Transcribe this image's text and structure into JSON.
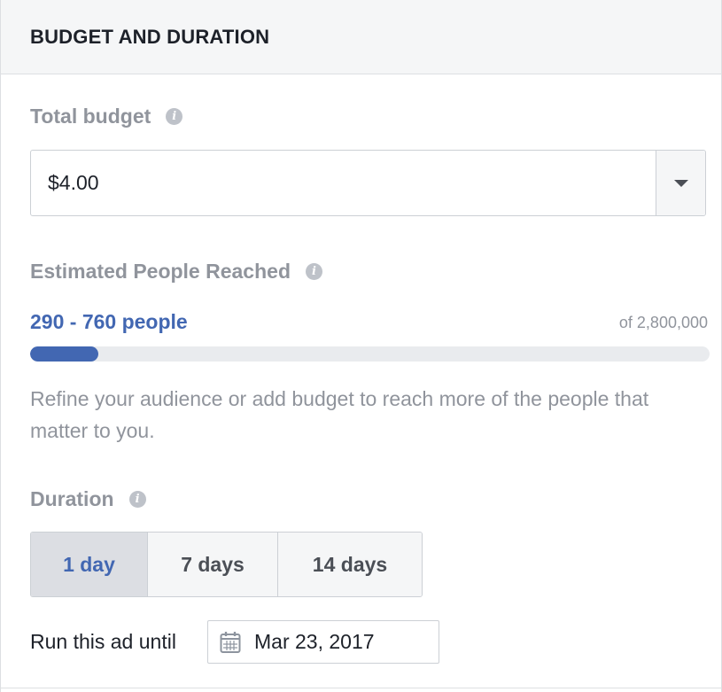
{
  "header": {
    "title": "BUDGET AND DURATION"
  },
  "budget": {
    "label": "Total budget",
    "info_icon": "info-icon",
    "value": "$4.00",
    "dropdown_icon": "caret-down-icon"
  },
  "reach": {
    "label": "Estimated People Reached",
    "info_icon": "info-icon",
    "range": "290 - 760 people",
    "total": "of 2,800,000",
    "fill_fraction": 0.1,
    "description": "Refine your audience or add budget to reach more of the people that matter to you."
  },
  "duration": {
    "label": "Duration",
    "info_icon": "info-icon",
    "options": [
      {
        "label": "1 day",
        "selected": true
      },
      {
        "label": "7 days",
        "selected": false
      },
      {
        "label": "14 days",
        "selected": false
      }
    ]
  },
  "run_until": {
    "label": "Run this ad until",
    "calendar_icon": "calendar-icon",
    "date": "Mar 23, 2017"
  },
  "colors": {
    "accent": "#4267b2",
    "muted_text": "#90949c",
    "border": "#ccd0d5",
    "header_bg": "#f5f6f7"
  }
}
